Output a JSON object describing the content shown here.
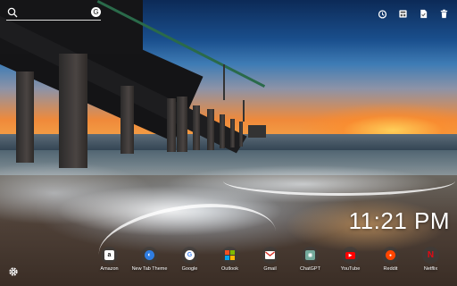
{
  "search": {
    "placeholder": "",
    "engine_icon": "google-icon"
  },
  "toolbar": [
    {
      "name": "alarm-icon",
      "glyph": "⏰"
    },
    {
      "name": "gallery-icon",
      "glyph": "▣"
    },
    {
      "name": "document-icon",
      "glyph": "🗎"
    },
    {
      "name": "trash-icon",
      "glyph": "🗑"
    }
  ],
  "clock": {
    "time": "11:21 PM"
  },
  "apps": [
    {
      "name": "amazon",
      "label": "Amazon",
      "glyph": "a",
      "color": "#ffffff",
      "fg": "#111111"
    },
    {
      "name": "new-tab-theme",
      "label": "New Tab Theme",
      "glyph": "◐",
      "color": "#2f7de1",
      "fg": "#ffffff"
    },
    {
      "name": "google",
      "label": "Google",
      "glyph": "G",
      "color": "#ffffff",
      "fg": "#4285f4"
    },
    {
      "name": "outlook",
      "label": "Outlook",
      "glyph": "⊞",
      "color": "#f25022",
      "fg": "#ffffff"
    },
    {
      "name": "gmail",
      "label": "Gmail",
      "glyph": "M",
      "color": "#ffffff",
      "fg": "#d93025"
    },
    {
      "name": "chatgpt",
      "label": "ChatGPT",
      "glyph": "✺",
      "color": "#74aa9c",
      "fg": "#ffffff"
    },
    {
      "name": "youtube",
      "label": "YouTube",
      "glyph": "▶",
      "color": "#ff0000",
      "fg": "#ffffff"
    },
    {
      "name": "reddit",
      "label": "Reddit",
      "glyph": "●",
      "color": "#ff4500",
      "fg": "#ffffff"
    },
    {
      "name": "netflix",
      "label": "Netflix",
      "glyph": "N",
      "color": "#141414",
      "fg": "#e50914"
    }
  ],
  "settings": {
    "icon": "gear-icon",
    "glyph": "⚙"
  }
}
